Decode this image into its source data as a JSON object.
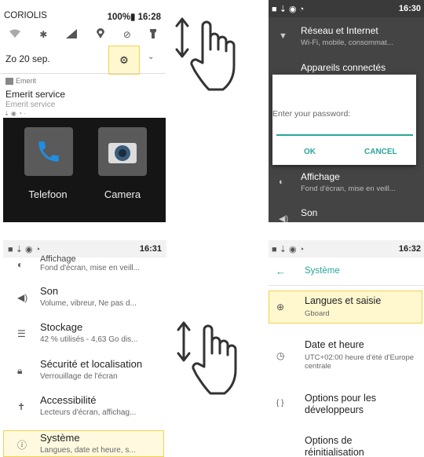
{
  "panel1": {
    "carrier": "CORIOLIS",
    "battery_time": "100%▮ 16:28",
    "date": "Zo 20 sep.",
    "notification_app": "Emerit",
    "notification_title": "Emerit service",
    "notification_text": "Emerit service",
    "apps": [
      {
        "label": "Telefoon",
        "icon": "phone-icon"
      },
      {
        "label": "Camera",
        "icon": "camera-icon"
      }
    ]
  },
  "panel2": {
    "time": "16:30",
    "rows": [
      {
        "title": "Réseau et Internet",
        "subtitle": "Wi-Fi, mobile, consommat..."
      },
      {
        "title": "Appareils connectés",
        "subtitle": ""
      },
      {
        "title": "Affichage",
        "subtitle": "Fond d'écran, mise en veill..."
      },
      {
        "title": "Son",
        "subtitle": ""
      }
    ],
    "dialog": {
      "prompt": "Enter your password:",
      "ok": "OK",
      "cancel": "CANCEL"
    }
  },
  "panel3": {
    "time": "16:31",
    "partial_title": "Affichage",
    "rows": [
      {
        "title": "",
        "subtitle": "Fond d'écran, mise en veill..."
      },
      {
        "title": "Son",
        "subtitle": "Volume, vibreur, Ne pas d..."
      },
      {
        "title": "Stockage",
        "subtitle": "42 % utilisés - 4,63 Go dis..."
      },
      {
        "title": "Sécurité et localisation",
        "subtitle": "Verrouillage de l'écran"
      },
      {
        "title": "Accessibilité",
        "subtitle": "Lecteurs d'écran, affichag..."
      },
      {
        "title": "Système",
        "subtitle": "Langues, date et heure, s..."
      }
    ]
  },
  "panel4": {
    "time": "16:32",
    "header": "Système",
    "rows": [
      {
        "title": "Langues et saisie",
        "subtitle": "Gboard"
      },
      {
        "title": "Date et heure",
        "subtitle": "UTC+02:00 heure d'été d'Europe centrale"
      },
      {
        "title": "Options pour les développeurs",
        "subtitle": ""
      },
      {
        "title": "Options de réinitialisation",
        "subtitle": ""
      }
    ]
  },
  "colors": {
    "accent": "#2aa59a",
    "highlight_border": "#f3d24b",
    "highlight_fill": "#fff8cf"
  }
}
